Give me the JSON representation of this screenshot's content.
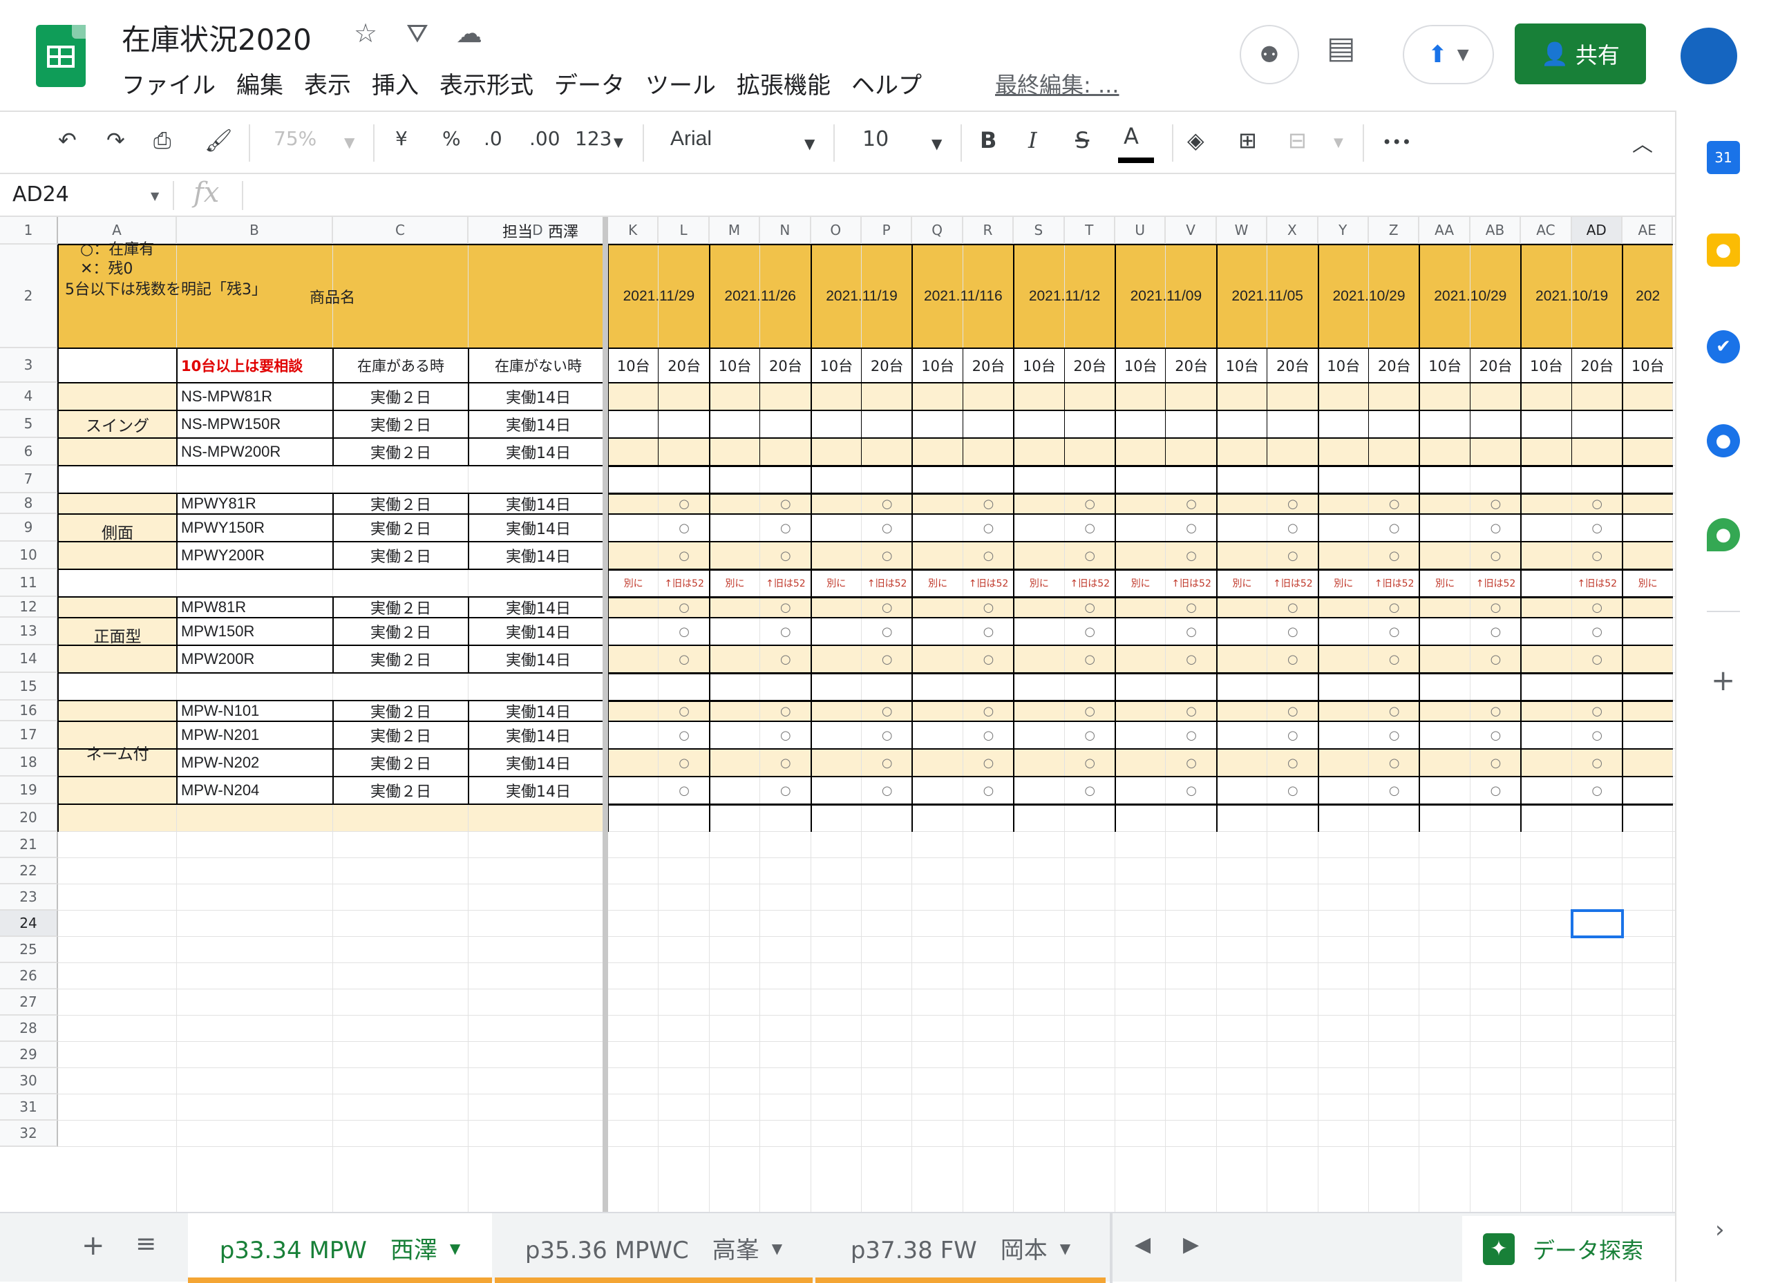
{
  "doc": {
    "title": "在庫状況2020"
  },
  "menu": [
    "ファイル",
    "編集",
    "表示",
    "挿入",
    "表示形式",
    "データ",
    "ツール",
    "拡張機能",
    "ヘルプ"
  ],
  "last_edit": "最終編集: ...",
  "share_label": "共有",
  "toolbar": {
    "zoom": "75%",
    "currency": "¥",
    "percent": "%",
    "dec_less": ".0",
    "dec_more": ".00",
    "format": "123",
    "font": "Arial",
    "font_size": "10",
    "bold": "B",
    "italic": "I",
    "strike": "S",
    "text_color": "A",
    "more": "•••"
  },
  "name_box": "AD24",
  "fx": "fx",
  "columns": [
    "A",
    "B",
    "C",
    "D",
    "K",
    "L",
    "M",
    "N",
    "O",
    "P",
    "Q",
    "R",
    "S",
    "T",
    "U",
    "V",
    "W",
    "X",
    "Y",
    "Z",
    "AA",
    "AB",
    "AC",
    "AD",
    "AE"
  ],
  "rows": [
    "1",
    "2",
    "3",
    "4",
    "5",
    "6",
    "7",
    "8",
    "9",
    "10",
    "11",
    "12",
    "13",
    "14",
    "15",
    "16",
    "17",
    "18",
    "19",
    "20",
    "21",
    "22",
    "23",
    "24",
    "25",
    "26",
    "27",
    "28",
    "29",
    "30",
    "31",
    "32"
  ],
  "legend": {
    "line1": "○：在庫有",
    "line2": "✕：残0",
    "line3": "5台以下は残数を明記「残3」"
  },
  "owner": "担当　西澤",
  "header_row": {
    "product": "商品名",
    "note": "10台以上は要相談",
    "in_stock": "在庫がある時",
    "out_stock": "在庫がない時"
  },
  "dates": [
    "2021.11/29",
    "2021.11/26",
    "2021.11/19",
    "2021.11/116",
    "2021.11/12",
    "2021.11/09",
    "2021.11/05",
    "2021.10/29",
    "2021.10/29",
    "2021.10/19",
    "202"
  ],
  "qty_labels": [
    "10台",
    "20台"
  ],
  "groups": [
    {
      "name": "スイング",
      "items": [
        "NS-MPW81R",
        "NS-MPW150R",
        "NS-MPW200R"
      ]
    },
    {
      "name": "側面",
      "items": [
        "MPWY81R",
        "MPWY150R",
        "MPWY200R"
      ]
    },
    {
      "name": "正面型",
      "items": [
        "MPW81R",
        "MPW150R",
        "MPW200R"
      ]
    },
    {
      "name": "ネーム付",
      "items": [
        "MPW-N101",
        "MPW-N201",
        "MPW-N202",
        "MPW-N204"
      ]
    }
  ],
  "lead_in": "実働２日",
  "lead_out": "実働14日",
  "circle": "○",
  "row11_notes": {
    "a": "別に",
    "b": "↑旧は52"
  },
  "sheets": [
    {
      "name": "p33.34 MPW　西澤",
      "active": true
    },
    {
      "name": "p35.36 MPWC　高峯",
      "active": false
    },
    {
      "name": "p37.38 FW　岡本",
      "active": false
    }
  ],
  "explore_label": "データ探索",
  "colors": {
    "gold": "#f1c24a",
    "cream": "#fdf0d0",
    "red": "#e00000",
    "green": "#188038",
    "orange": "#f4a534",
    "blue": "#1a73e8"
  },
  "icons": [
    "star-icon",
    "move-to-drive-icon",
    "cloud-status-icon",
    "meet-icon",
    "comment-icon",
    "present-icon",
    "person-icon",
    "undo-icon",
    "redo-icon",
    "print-icon",
    "paint-format-icon",
    "fill-color-icon",
    "borders-icon",
    "merge-icon",
    "collapse-icon",
    "calendar-icon",
    "keep-icon",
    "tasks-icon",
    "contacts-icon",
    "maps-icon",
    "add-icon",
    "add-sheet-icon",
    "all-sheets-icon",
    "explore-icon"
  ]
}
